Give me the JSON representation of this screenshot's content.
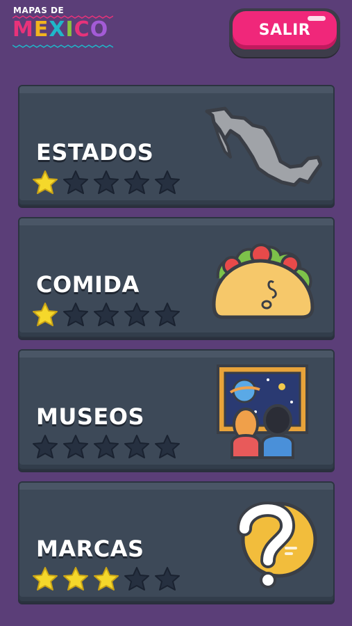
{
  "logo": {
    "line1": "MAPAS DE",
    "line2": "MEXICO",
    "letter_colors": [
      "#e8327a",
      "#f2b41e",
      "#1fb7c9",
      "#8ac43f",
      "#e8327a",
      "#a35bd6"
    ]
  },
  "header": {
    "exit_label": "SALIR"
  },
  "colors": {
    "background": "#5b3e78",
    "card": "#3d4958",
    "star_filled": "#f5d82b",
    "star_empty": "#263040",
    "exit_button": "#f0277a"
  },
  "categories": [
    {
      "label": "ESTADOS",
      "stars_earned": 1,
      "stars_total": 5,
      "icon": "mexico-map-icon"
    },
    {
      "label": "COMIDA",
      "stars_earned": 1,
      "stars_total": 5,
      "icon": "taco-icon"
    },
    {
      "label": "MUSEOS",
      "stars_earned": 0,
      "stars_total": 5,
      "icon": "museum-painting-icon"
    },
    {
      "label": "MARCAS",
      "stars_earned": 3,
      "stars_total": 5,
      "icon": "question-mark-icon"
    }
  ]
}
